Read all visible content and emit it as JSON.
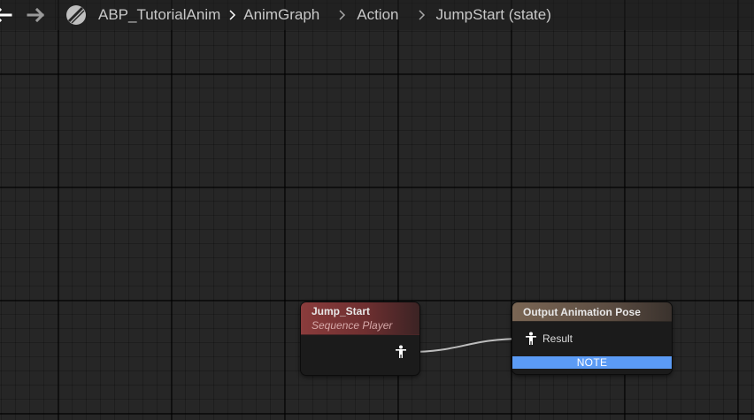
{
  "breadcrumb": {
    "items": [
      {
        "label": "ABP_TutorialAnim"
      },
      {
        "label": "AnimGraph"
      },
      {
        "label": "Action"
      },
      {
        "label": "JumpStart (state)"
      }
    ]
  },
  "icons": {
    "back": "arrow-left-icon",
    "forward": "arrow-right-icon",
    "blueprint": "animation-blueprint-icon",
    "separator": "chevron-right-icon",
    "pose_pin": "pose-figure-icon"
  },
  "nodes": {
    "sequence_player": {
      "title": "Jump_Start",
      "subtitle": "Sequence Player"
    },
    "output_pose": {
      "title": "Output Animation Pose",
      "result_pin": "Result",
      "note": "NOTE"
    }
  },
  "colors": {
    "background": "#262626",
    "sequence_header": "#8a3c3c",
    "output_header": "#7a6654",
    "note": "#5b9bf5",
    "wire": "#bdbdbd"
  }
}
